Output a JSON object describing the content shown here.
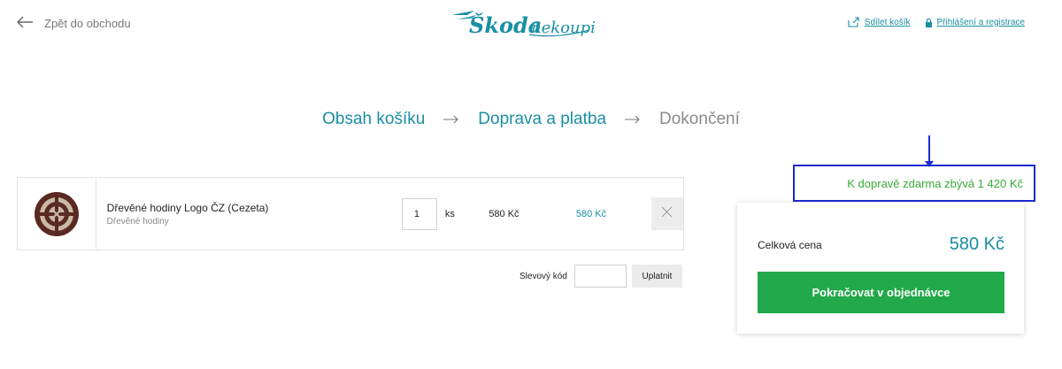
{
  "header": {
    "back_label": "Zpět do obchodu",
    "logo_text": "Škoda nekoupit",
    "share_label": "Sdílet košík",
    "login_label": "Přihlášení a registrace"
  },
  "steps": [
    {
      "label": "Obsah košíku",
      "active": true
    },
    {
      "label": "Doprava a platba",
      "active": true
    },
    {
      "label": "Dokončení",
      "active": false
    }
  ],
  "cart": {
    "items": [
      {
        "name": "Dřevěné hodiny Logo ČZ (Cezeta)",
        "category": "Dřevěné hodiny",
        "quantity": "1",
        "unit": "ks",
        "unit_price": "580 Kč",
        "total_price": "580 Kč"
      }
    ]
  },
  "discount": {
    "label": "Slevový kód",
    "value": "",
    "apply_label": "Uplatnit"
  },
  "free_shipping": {
    "text": "K dopravě zdarma zbývá 1 420 Kč"
  },
  "summary": {
    "total_label": "Celková cena",
    "total_value": "580 Kč",
    "continue_label": "Pokračovat v objednávce"
  },
  "colors": {
    "accent": "#1a8fa3",
    "success": "#22a94b",
    "annotation": "#1b2bd1",
    "free_shipping_text": "#3aa93c"
  }
}
